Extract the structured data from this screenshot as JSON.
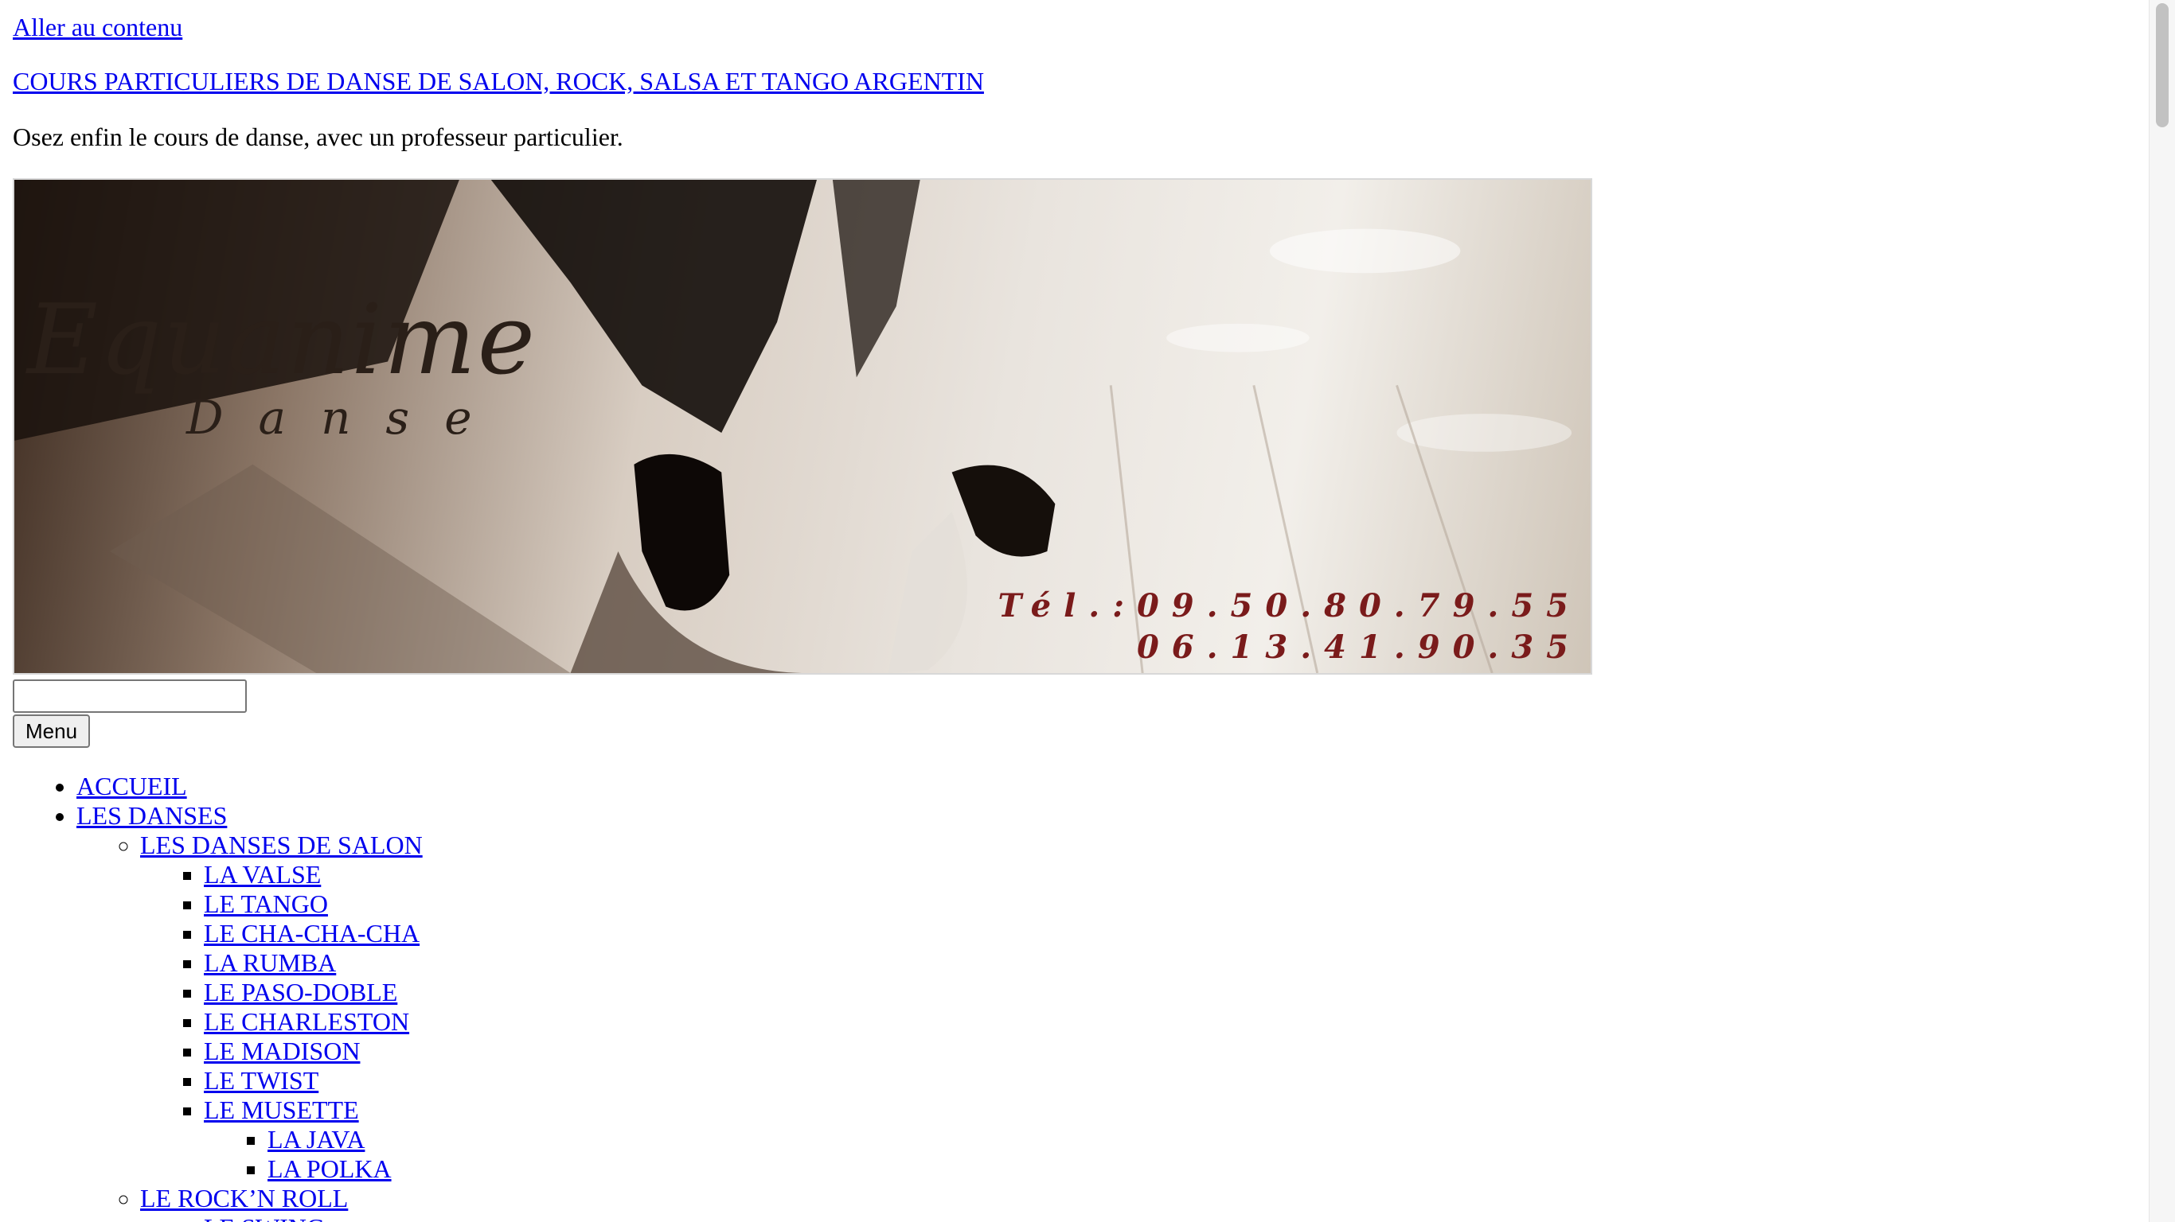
{
  "skip_link": "Aller au contenu",
  "site_title": "COURS PARTICULIERS DE DANSE DE SALON, ROCK, SALSA ET TANGO ARGENTIN",
  "tagline": "Osez enfin le cours de danse, avec un professeur particulier.",
  "banner": {
    "logo_main": "Equanime",
    "logo_sub": "Danse",
    "phone_line1": "Tél.:09.50.80.79.55",
    "phone_line2": "06.13.41.90.35",
    "phone_color": "#7a1b1b"
  },
  "search": {
    "value": "",
    "placeholder": ""
  },
  "menu_button": "Menu",
  "nav": {
    "accueil": "ACCUEIL",
    "les_danses": "LES DANSES",
    "danses_de_salon": "LES DANSES DE SALON",
    "salon_items": [
      "LA VALSE",
      "LE TANGO",
      "LE CHA-CHA-CHA",
      "LA RUMBA",
      "LE PASO-DOBLE",
      "LE CHARLESTON",
      "LE MADISON",
      "LE TWIST",
      "LE MUSETTE"
    ],
    "musette_items": [
      "LA JAVA",
      "LA POLKA"
    ],
    "rock_n_roll": "LE ROCK’N ROLL",
    "rock_items": [
      "LE SWING"
    ]
  },
  "colors": {
    "link": "#0000ee",
    "text": "#000000"
  }
}
